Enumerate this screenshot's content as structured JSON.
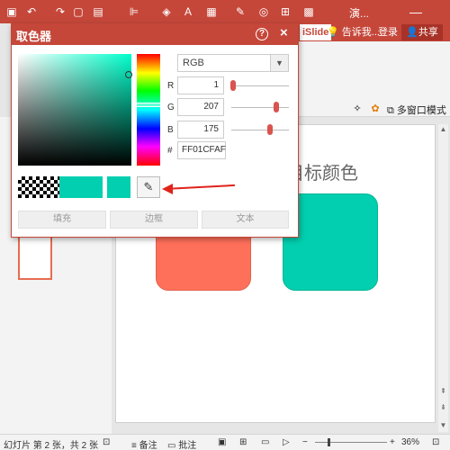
{
  "titlebar": {
    "icons": [
      "save-icon",
      "undo-icon",
      "redo-icon",
      "new-file-icon",
      "open-icon",
      "align-icon",
      "bucket-icon",
      "text-icon",
      "paste-icon",
      "shape-icon",
      "fill-icon",
      "group-icon",
      "screenshot-icon"
    ],
    "title": "演...",
    "minimize": "—"
  },
  "ribbon": {
    "islide_tab": "iSlide",
    "tell_me": "告诉我...",
    "login": "登录",
    "share": "共享",
    "multi_window": "多窗口模式"
  },
  "dialog": {
    "title": "取色器",
    "help": "?",
    "close": "×",
    "mode": {
      "value": "RGB",
      "options": [
        "RGB"
      ]
    },
    "channels": [
      {
        "label": "R",
        "value": "1",
        "level": 0.004
      },
      {
        "label": "G",
        "value": "207",
        "level": 0.81
      },
      {
        "label": "B",
        "value": "175",
        "level": 0.69
      }
    ],
    "hex_label": "#",
    "hex_value": "FF01CFAF",
    "current_color": "#01cfaf",
    "buttons": {
      "fill": "填充",
      "border": "边框",
      "text": "文本"
    }
  },
  "slide": {
    "title": "目标颜色",
    "shape_colors": {
      "left": "#ff705a",
      "right": "#01cfaf"
    }
  },
  "statusbar": {
    "slide_info": "幻灯片 第 2 张，共 2 张",
    "notes": "备注",
    "comments": "批注",
    "zoom": "36%"
  },
  "colors": {
    "accent": "#c5473a",
    "arrow": "#e0231b"
  }
}
